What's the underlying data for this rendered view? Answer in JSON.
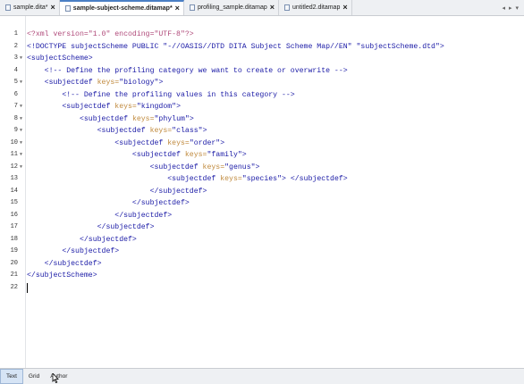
{
  "tabs": [
    {
      "label": "sample.dita*",
      "active": false,
      "icon": "file-icon"
    },
    {
      "label": "sample-subject-scheme.ditamap*",
      "active": true,
      "icon": "file-icon"
    },
    {
      "label": "profiling_sample.ditamap",
      "active": false,
      "icon": "file-icon"
    },
    {
      "label": "untitled2.ditamap",
      "active": false,
      "icon": "file-icon"
    }
  ],
  "editor": {
    "lines": [
      {
        "n": "1",
        "fold": false,
        "parts": [
          [
            "pi",
            "<?xml version=\"1.0\" encoding=\"UTF-8\"?>"
          ]
        ]
      },
      {
        "n": "2",
        "fold": false,
        "parts": [
          [
            "tag",
            "<!DOCTYPE subjectScheme PUBLIC \"-//OASIS//DTD DITA Subject Scheme Map//EN\" \"subjectScheme.dtd\">"
          ]
        ]
      },
      {
        "n": "3",
        "fold": true,
        "parts": [
          [
            "tag",
            "<subjectScheme>"
          ]
        ]
      },
      {
        "n": "4",
        "fold": false,
        "parts": [
          [
            "sp",
            "    "
          ],
          [
            "cmt",
            "<!-- Define the profiling category we want to create or overwrite -->"
          ]
        ]
      },
      {
        "n": "5",
        "fold": true,
        "parts": [
          [
            "sp",
            "    "
          ],
          [
            "tag",
            "<subjectdef "
          ],
          [
            "attr",
            "keys="
          ],
          [
            "val",
            "\"biology\""
          ],
          [
            "tag",
            ">"
          ]
        ]
      },
      {
        "n": "6",
        "fold": false,
        "parts": [
          [
            "sp",
            "        "
          ],
          [
            "cmt",
            "<!-- Define the profiling values in this category -->"
          ]
        ]
      },
      {
        "n": "7",
        "fold": true,
        "parts": [
          [
            "sp",
            "        "
          ],
          [
            "tag",
            "<subjectdef "
          ],
          [
            "attr",
            "keys="
          ],
          [
            "val",
            "\"kingdom\""
          ],
          [
            "tag",
            ">"
          ]
        ]
      },
      {
        "n": "8",
        "fold": true,
        "parts": [
          [
            "sp",
            "            "
          ],
          [
            "tag",
            "<subjectdef "
          ],
          [
            "attr",
            "keys="
          ],
          [
            "val",
            "\"phylum\""
          ],
          [
            "tag",
            ">"
          ]
        ]
      },
      {
        "n": "9",
        "fold": true,
        "parts": [
          [
            "sp",
            "                "
          ],
          [
            "tag",
            "<subjectdef "
          ],
          [
            "attr",
            "keys="
          ],
          [
            "val",
            "\"class\""
          ],
          [
            "tag",
            ">"
          ]
        ]
      },
      {
        "n": "10",
        "fold": true,
        "parts": [
          [
            "sp",
            "                    "
          ],
          [
            "tag",
            "<subjectdef "
          ],
          [
            "attr",
            "keys="
          ],
          [
            "val",
            "\"order\""
          ],
          [
            "tag",
            ">"
          ]
        ]
      },
      {
        "n": "11",
        "fold": true,
        "parts": [
          [
            "sp",
            "                        "
          ],
          [
            "tag",
            "<subjectdef "
          ],
          [
            "attr",
            "keys="
          ],
          [
            "val",
            "\"family\""
          ],
          [
            "tag",
            ">"
          ]
        ]
      },
      {
        "n": "12",
        "fold": true,
        "parts": [
          [
            "sp",
            "                            "
          ],
          [
            "tag",
            "<subjectdef "
          ],
          [
            "attr",
            "keys="
          ],
          [
            "val",
            "\"genus\""
          ],
          [
            "tag",
            ">"
          ]
        ]
      },
      {
        "n": "13",
        "fold": false,
        "parts": [
          [
            "sp",
            "                                "
          ],
          [
            "tag",
            "<subjectdef "
          ],
          [
            "attr",
            "keys="
          ],
          [
            "val",
            "\"species\""
          ],
          [
            "tag",
            "> </subjectdef>"
          ]
        ]
      },
      {
        "n": "14",
        "fold": false,
        "parts": [
          [
            "sp",
            "                            "
          ],
          [
            "tag",
            "</subjectdef>"
          ]
        ]
      },
      {
        "n": "15",
        "fold": false,
        "parts": [
          [
            "sp",
            "                        "
          ],
          [
            "tag",
            "</subjectdef>"
          ]
        ]
      },
      {
        "n": "16",
        "fold": false,
        "parts": [
          [
            "sp",
            "                    "
          ],
          [
            "tag",
            "</subjectdef>"
          ]
        ]
      },
      {
        "n": "17",
        "fold": false,
        "parts": [
          [
            "sp",
            "                "
          ],
          [
            "tag",
            "</subjectdef>"
          ]
        ]
      },
      {
        "n": "18",
        "fold": false,
        "parts": [
          [
            "sp",
            "            "
          ],
          [
            "tag",
            "</subjectdef>"
          ]
        ]
      },
      {
        "n": "19",
        "fold": false,
        "parts": [
          [
            "sp",
            "        "
          ],
          [
            "tag",
            "</subjectdef>"
          ]
        ]
      },
      {
        "n": "20",
        "fold": false,
        "parts": [
          [
            "sp",
            "    "
          ],
          [
            "tag",
            "</subjectdef>"
          ]
        ]
      },
      {
        "n": "21",
        "fold": false,
        "parts": [
          [
            "tag",
            "</subjectScheme>"
          ]
        ]
      },
      {
        "n": "22",
        "fold": false,
        "parts": []
      }
    ]
  },
  "modes": [
    {
      "label": "Text",
      "active": true
    },
    {
      "label": "Grid",
      "active": false
    },
    {
      "label": "Author",
      "active": false
    }
  ],
  "colors": {
    "accent": "#4a7fc4",
    "tag": "#1a1aa6",
    "attr": "#c08a3e",
    "pi": "#b04a7a"
  }
}
